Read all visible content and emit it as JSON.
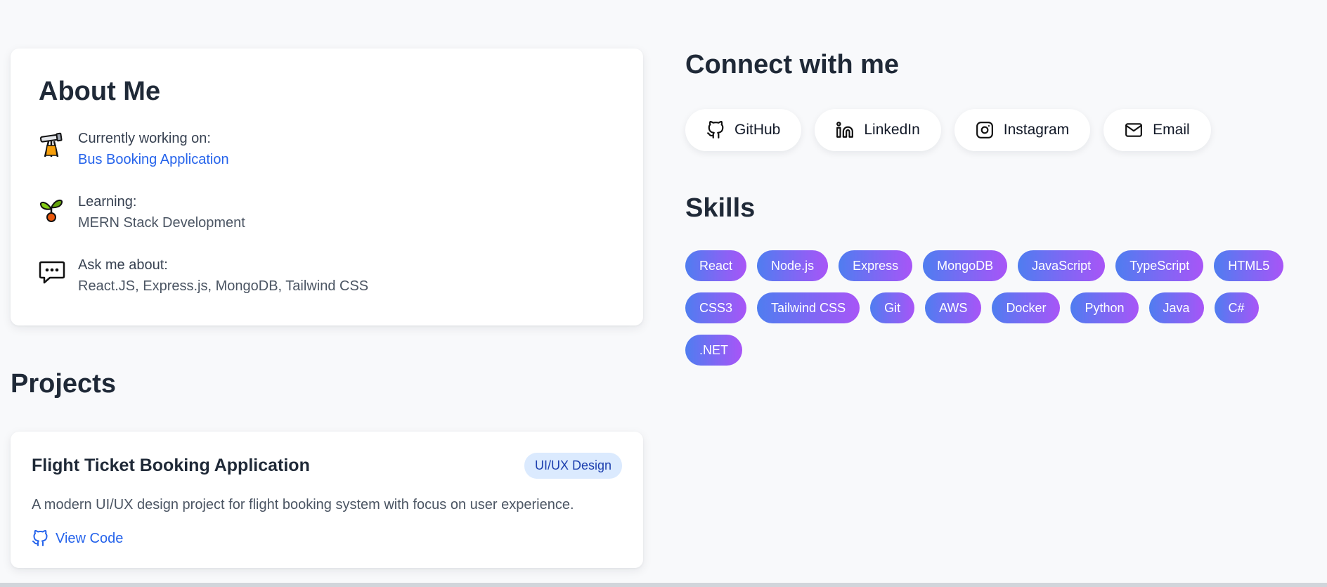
{
  "about": {
    "title": "About Me",
    "items": [
      {
        "icon": "telescope-icon",
        "label": "Currently working on:",
        "value": "Bus Booking Application"
      },
      {
        "icon": "seedling-icon",
        "label": "Learning:",
        "value": "MERN Stack Development"
      },
      {
        "icon": "speech-bubble-icon",
        "label": "Ask me about:",
        "value": "React.JS, Express.js, MongoDB, Tailwind CSS"
      }
    ]
  },
  "projects": {
    "title": "Projects",
    "items": [
      {
        "title": "Flight Ticket Booking Application",
        "tag": "UI/UX Design",
        "description": "A modern UI/UX design project for flight booking system with focus on user experience.",
        "link_label": "View Code"
      }
    ]
  },
  "connect": {
    "title": "Connect with me",
    "links": [
      {
        "label": "GitHub",
        "icon": "github-icon"
      },
      {
        "label": "LinkedIn",
        "icon": "linkedin-icon"
      },
      {
        "label": "Instagram",
        "icon": "instagram-icon"
      },
      {
        "label": "Email",
        "icon": "mail-icon"
      }
    ]
  },
  "skills": {
    "title": "Skills",
    "items": [
      "React",
      "Node.js",
      "Express",
      "MongoDB",
      "JavaScript",
      "TypeScript",
      "HTML5",
      "CSS3",
      "Tailwind CSS",
      "Git",
      "AWS",
      "Docker",
      "Python",
      "Java",
      "C#",
      ".NET"
    ]
  },
  "colors": {
    "accent": "#2563eb",
    "gradient_start": "#4f7df0",
    "gradient_end": "#a855f7",
    "tag_bg": "#dbeafe"
  }
}
